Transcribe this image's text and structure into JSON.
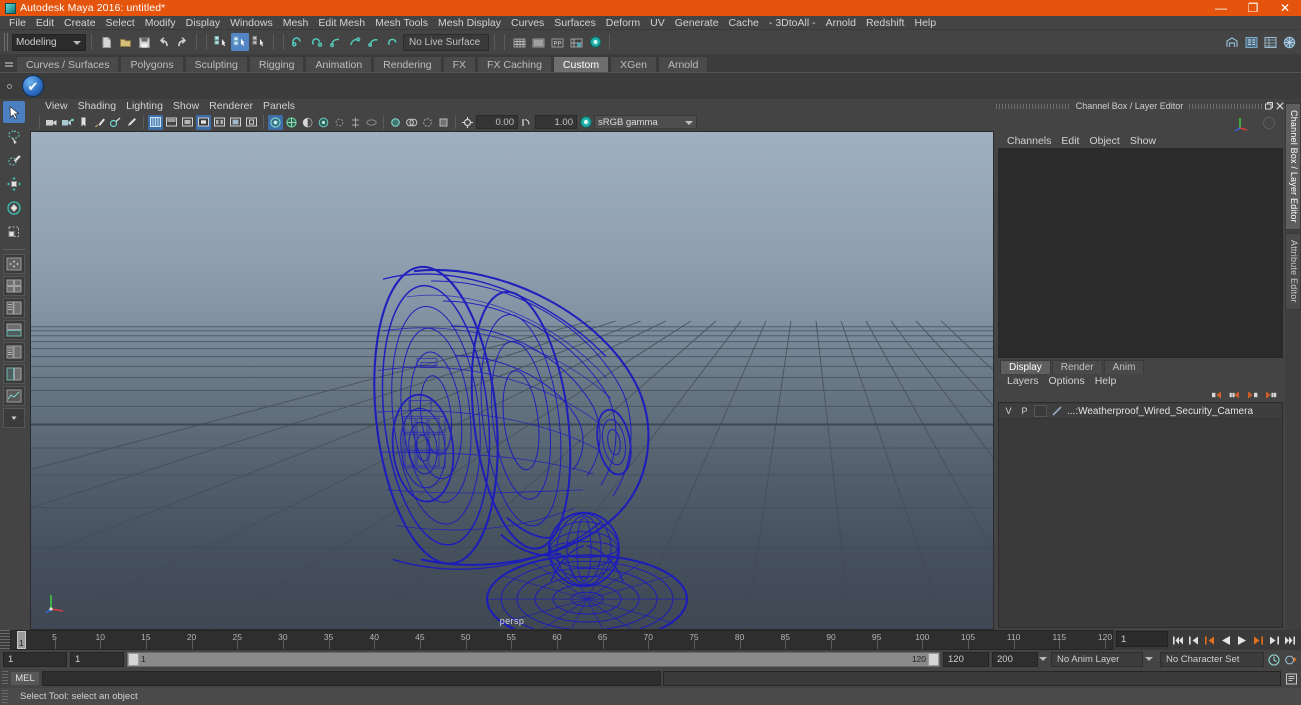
{
  "window": {
    "title": "Autodesk Maya 2016: untitled*",
    "app_icon": "maya-logo-icon",
    "titlebar_color": "#e4540d",
    "buttons": {
      "minimize": "—",
      "maximize": "❐",
      "close": "✕"
    }
  },
  "menubar": {
    "items": [
      "File",
      "Edit",
      "Create",
      "Select",
      "Modify",
      "Display",
      "Windows",
      "Mesh",
      "Edit Mesh",
      "Mesh Tools",
      "Mesh Display",
      "Curves",
      "Surfaces",
      "Deform",
      "UV",
      "Generate",
      "Cache",
      "- 3DtoAll -",
      "Arnold",
      "Redshift",
      "Help"
    ]
  },
  "statusline": {
    "menuset": {
      "value": "Modeling",
      "caret": "chevron-down-icon"
    },
    "file_icons": [
      "new-scene-icon",
      "open-scene-icon",
      "save-scene-icon",
      "undo-icon",
      "redo-icon"
    ],
    "select_mode_icons": [
      "select-by-hierarchy-icon",
      "select-by-object-type-icon",
      "select-by-component-type-icon"
    ],
    "select_mode_active_index": 1,
    "mask_icons": [
      "mask-handles-icon",
      "mask-joints-icon",
      "mask-curves-icon",
      "mask-surfaces-icon",
      "mask-deformers-icon",
      "mask-dynamics-icon"
    ],
    "live_surface": {
      "label": "No Live Surface"
    },
    "snap_icons": [
      "snap-to-grid-icon",
      "snap-to-curve-icon",
      "snap-to-point-icon",
      "snap-to-projected-center-icon",
      "snap-to-view-plane-icon"
    ],
    "editor_icons": [
      "show-hide-attribute-editor-icon",
      "show-hide-tool-settings-icon",
      "show-hide-channel-box-icon",
      "show-hide-modeling-toolkit-icon"
    ]
  },
  "shelf": {
    "tabs": [
      "Curves / Surfaces",
      "Polygons",
      "Sculpting",
      "Rigging",
      "Animation",
      "Rendering",
      "FX",
      "FX Caching",
      "Custom",
      "XGen",
      "Arnold"
    ],
    "active_tab": "Custom",
    "buttons": [
      {
        "icon": "blue-check-shelf-icon",
        "glyph": "✔"
      }
    ]
  },
  "toolbox": {
    "tools": [
      {
        "name": "select-tool",
        "active": true
      },
      {
        "name": "lasso-select-tool",
        "active": false
      },
      {
        "name": "paint-select-tool",
        "active": false
      },
      {
        "name": "move-tool",
        "active": false
      },
      {
        "name": "rotate-tool",
        "active": false
      },
      {
        "name": "scale-tool",
        "active": false
      }
    ],
    "layout_presets": [
      "single-perspective-layout",
      "four-view-layout",
      "two-panes-side-layout",
      "two-panes-stacked-layout",
      "three-panes-layout",
      "outliner-persp-layout",
      "hypershade-persp-layout",
      "persp-graph-layout",
      "more-layouts"
    ]
  },
  "viewport": {
    "panel_menus": [
      "View",
      "Shading",
      "Lighting",
      "Show",
      "Renderer",
      "Panels"
    ],
    "camera_label": "persp",
    "toolbar": {
      "exposure_value": "0.00",
      "gamma_value": "1.00",
      "color_management": "sRGB gamma",
      "gamma_caret": "chevron-down-icon",
      "icons": [
        "select-camera-icon",
        "camera-attributes-icon",
        "bookmarks-icon",
        "image-plane-icon",
        "twoD-pan-zoom-icon",
        "grease-pencil-icon",
        "wireframe-icon",
        "smooth-shade-all-icon",
        "smooth-shade-selected-icon",
        "flat-shade-icon",
        "shaded-wireframe-icon",
        "textured-icon",
        "lighting-icon",
        "use-default-lighting-icon",
        "use-all-lights-icon",
        "shadows-icon",
        "screen-space-ao-icon",
        "motion-blur-icon",
        "multisample-icon",
        "depth-of-field-icon",
        "isolate-select-icon",
        "xray-icon",
        "xray-joints-icon",
        "xray-active-components-icon",
        "exposure-icon",
        "gamma-icon",
        "color-management-icon"
      ]
    },
    "scene": {
      "object_name": "Weatherproof_Wired_Security_Camera",
      "selected": true,
      "wireframe_color": "#1b1bbe",
      "sky_top_color": "#9fb0c1",
      "sky_bottom_color": "#424b57",
      "grid_color": "#4d5864",
      "axis_x_color": "#cc3333",
      "axis_y_color": "#33cc33",
      "axis_z_color": "#3355cc"
    }
  },
  "channelbox": {
    "title": "Channel Box / Layer Editor",
    "window_buttons": [
      "undock-icon",
      "close-icon"
    ],
    "menus": [
      "Channels",
      "Edit",
      "Object",
      "Show"
    ],
    "contents": []
  },
  "layer_editor": {
    "tabs": [
      "Display",
      "Render",
      "Anim"
    ],
    "active_tab": "Display",
    "menus": [
      "Layers",
      "Options",
      "Help"
    ],
    "toolbar_icons": [
      "new-layer-icon",
      "new-layer-from-selected-icon",
      "select-objects-in-layer-icon",
      "add-selected-to-layer-icon"
    ],
    "layers": [
      {
        "visibility": "V",
        "playback": "P",
        "shading": "",
        "color": "#9aa8c8",
        "name": "...:Weatherproof_Wired_Security_Camera"
      }
    ]
  },
  "right_tabs": {
    "items": [
      "Channel Box / Layer Editor",
      "Attribute Editor"
    ],
    "active": "Channel Box / Layer Editor"
  },
  "timeslider": {
    "start": 1,
    "end": 120,
    "current_frame": "1",
    "current_frame_field": "1",
    "tick_labels": [
      5,
      10,
      15,
      20,
      25,
      30,
      35,
      40,
      45,
      50,
      55,
      60,
      65,
      70,
      75,
      80,
      85,
      90,
      95,
      100,
      105,
      110,
      115,
      120
    ],
    "playback_icons": [
      "go-to-start-icon",
      "step-back-frame-icon",
      "step-back-key-icon",
      "play-backwards-icon",
      "play-forwards-icon",
      "step-forward-key-icon",
      "step-forward-frame-icon",
      "go-to-end-icon"
    ]
  },
  "rangeslider": {
    "anim_start": "1",
    "range_start": "1",
    "range_bar_start_label": "1",
    "range_bar_end_label": "120",
    "range_end": "120",
    "anim_end": "200",
    "anim_layer": "No Anim Layer",
    "character_set": "No Character Set",
    "auto_key_icon": "auto-keyframe-icon",
    "anim_prefs_icon": "animation-preferences-icon"
  },
  "commandline": {
    "mode_label": "MEL",
    "input_value": "",
    "script_editor_icon": "script-editor-icon"
  },
  "helpline": {
    "text": "Select Tool: select an object"
  }
}
